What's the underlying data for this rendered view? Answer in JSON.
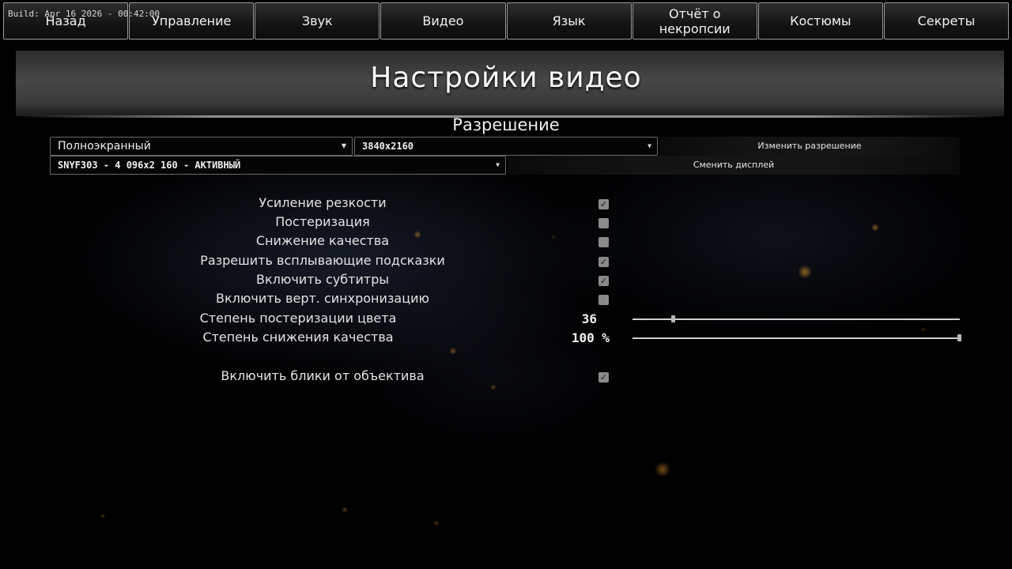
{
  "build_label": "Build: Apr 16 2026 - 00:42:00",
  "nav": {
    "tabs": [
      {
        "label": "Назад"
      },
      {
        "label": "Управление"
      },
      {
        "label": "Звук"
      },
      {
        "label": "Видео"
      },
      {
        "label": "Язык"
      },
      {
        "label": "Отчёт о некропсии"
      },
      {
        "label": "Костюмы"
      },
      {
        "label": "Секреты"
      }
    ]
  },
  "page": {
    "title": "Настройки видео",
    "section_title": "Разрешение"
  },
  "display": {
    "mode_value": "Полноэкранный",
    "resolution_value": "3840x2160",
    "apply_resolution_label": "Изменить разрешение",
    "monitor_value": "SNYF303 - 4 096x2 160 - АКТИВНЫЙ",
    "change_display_label": "Сменить дисплей"
  },
  "settings": {
    "sharpening": {
      "label": "Усиление резкости",
      "checked": true
    },
    "posterization": {
      "label": "Постеризация",
      "checked": false
    },
    "quality_reduction": {
      "label": "Снижение качества",
      "checked": false
    },
    "tooltips": {
      "label": "Разрешить всплывающие подсказки",
      "checked": true
    },
    "subtitles": {
      "label": "Включить субтитры",
      "checked": true
    },
    "vsync": {
      "label": "Включить верт. синхронизацию",
      "checked": false
    },
    "posterization_level": {
      "label": "Степень постеризации цвета",
      "value_text": "36",
      "fraction": 0.125
    },
    "quality_reduction_level": {
      "label": "Степень снижения качества",
      "value_text": "100 %",
      "fraction": 1.0
    },
    "lens_flares": {
      "label": "Включить блики от объектива",
      "checked": true
    }
  },
  "icons": {
    "dropdown_caret": "caret-down-icon",
    "checkmark": "check-icon"
  },
  "colors": {
    "background": "#000000",
    "checkbox": "#8a8a8a",
    "ember": "#ff9a2a"
  }
}
